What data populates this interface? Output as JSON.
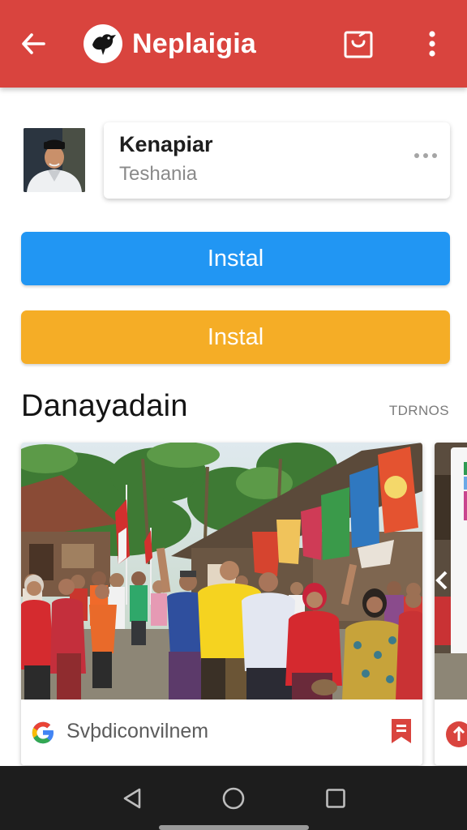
{
  "app": {
    "title": "Neplaigia",
    "colors": {
      "toolbar": "#d9443e",
      "primary_button": "#2196f3",
      "secondary_button": "#f5ad26",
      "bookmark": "#d9443e"
    },
    "icons": {
      "back": "arrow-left-icon",
      "logo": "bird-logo-icon",
      "bag": "shopping-bag-icon",
      "more": "more-vert-icon"
    }
  },
  "contact": {
    "name": "Kenapiar",
    "subtitle": "Teshania"
  },
  "buttons": {
    "primary_label": "Instal",
    "secondary_label": "Instal"
  },
  "section": {
    "title": "Danayadain",
    "link": "TDRNOS"
  },
  "card": {
    "source_text": "Svþdiconvilnem",
    "icons": {
      "source": "google-icon",
      "action": "bookmark-icon"
    }
  },
  "nav": {
    "icons": [
      "back-triangle-icon",
      "home-circle-icon",
      "recents-square-icon"
    ]
  }
}
